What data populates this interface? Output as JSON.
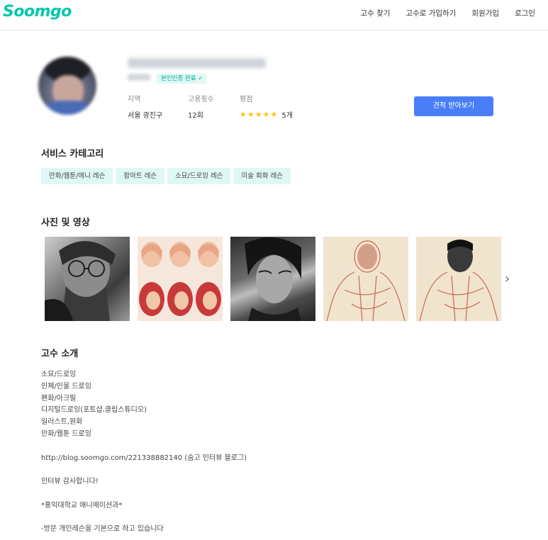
{
  "header": {
    "logo": "Soomgo",
    "nav": [
      "고수 찾기",
      "고수로 가입하기",
      "회원가입",
      "로그인"
    ]
  },
  "profile": {
    "verified_badge": "본인인증 완료 ✓",
    "stats": {
      "region_label": "지역",
      "region_value": "서울 광진구",
      "hires_label": "고용횟수",
      "hires_value": "12회",
      "rating_label": "평점",
      "rating_stars": 5,
      "review_count": "5개"
    },
    "quote_button": "견적 받아보기"
  },
  "services": {
    "title": "서비스 카테고리",
    "chips": [
      "만화/웹툰/애니 레슨",
      "팝아트 레슨",
      "소묘/드로잉 레슨",
      "미술 회화 레슨"
    ]
  },
  "media": {
    "title": "사진 및 영상",
    "next_icon": "chevron-right-icon"
  },
  "intro": {
    "title": "고수 소개",
    "lines": [
      "소묘/드로잉",
      "인체/인물 드로잉",
      "펜화/아크릴",
      "디지털드로잉(포토샵,클립스튜디오)",
      "일러스트,원화",
      "만화/웹툰 드로잉",
      "",
      "http://blog.soomgo.com/221338882140 (숨고 인터뷰 블로그)",
      "",
      "인터뷰 감사합니다!",
      "",
      "*홍익대학교 애니메이션과*",
      "",
      "-방문 개인레슨을 기본으로 하고 있습니다"
    ]
  },
  "colors": {
    "brand": "#00c7ae",
    "primary_button": "#4a7ef8",
    "chip_bg": "#dff8f5",
    "star": "#ffc21a"
  }
}
